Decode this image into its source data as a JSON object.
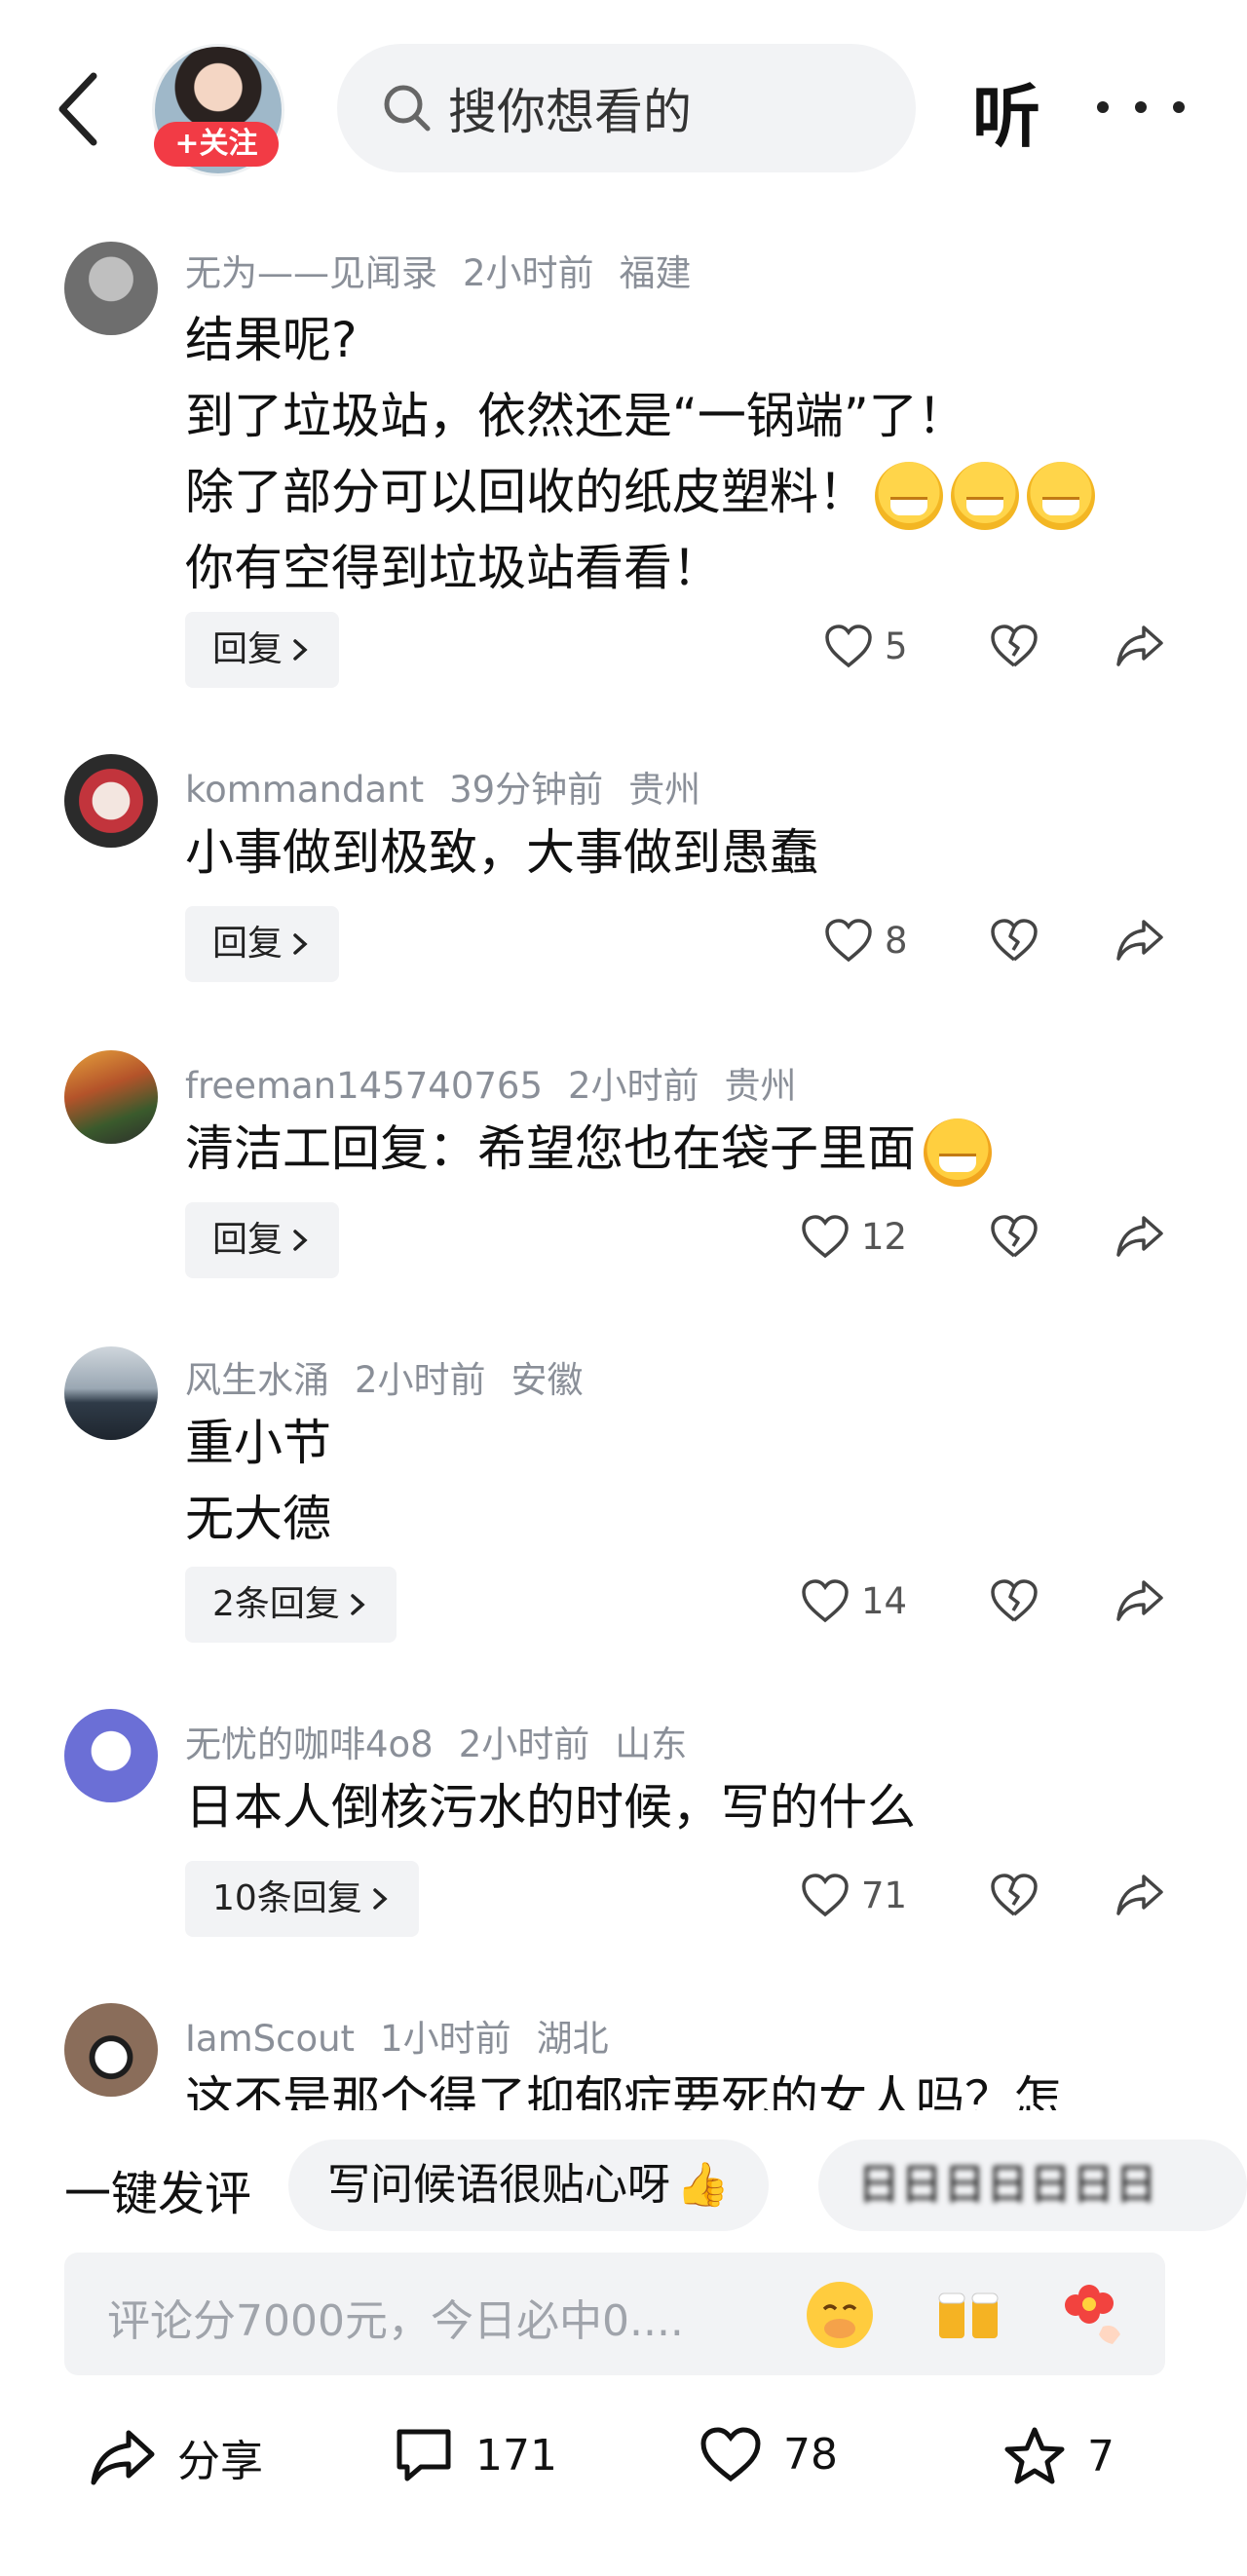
{
  "header": {
    "follow_label": "+关注",
    "search_placeholder": "搜你想看的",
    "listen_label": "听"
  },
  "comments": [
    {
      "user": "无为——见闻录",
      "time": "2小时前",
      "location": "福建",
      "lines": [
        "结果呢?",
        "到了垃圾站，依然还是“一锅端”了！",
        "除了部分可以回收的纸皮塑料！",
        "你有空得到垃圾站看看！"
      ],
      "reply_label": "回复",
      "likes": "5"
    },
    {
      "user": "kommandant",
      "time": "39分钟前",
      "location": "贵州",
      "lines": [
        "小事做到极致，大事做到愚蠢"
      ],
      "reply_label": "回复",
      "likes": "8"
    },
    {
      "user": "freeman145740765",
      "time": "2小时前",
      "location": "贵州",
      "lines": [
        "清洁工回复：希望您也在袋子里面"
      ],
      "reply_label": "回复",
      "likes": "12"
    },
    {
      "user": "风生水涌",
      "time": "2小时前",
      "location": "安徽",
      "lines": [
        "重小节",
        "无大德"
      ],
      "reply_label": "2条回复",
      "likes": "14"
    },
    {
      "user": "无忧的咖啡4o8",
      "time": "2小时前",
      "location": "山东",
      "lines": [
        "日本人倒核污水的时候，写的什么"
      ],
      "reply_label": "10条回复",
      "likes": "71"
    },
    {
      "user": "IamScout",
      "time": "1小时前",
      "location": "湖北",
      "lines": [
        "这不是那个得了抑郁症要死的女人吗？怎"
      ]
    }
  ],
  "quick": {
    "label": "一键发评",
    "chip1": "写问候语很贴心呀",
    "chip2": "日日日日日日日"
  },
  "input": {
    "placeholder": "评论分7000元，今日必中0...."
  },
  "bottom": {
    "share_label": "分享",
    "comments_count": "171",
    "likes_count": "78",
    "favorites_count": "7"
  },
  "colors": {
    "accent_red": "#f23b45",
    "meta_gray": "#8a8f98",
    "chip_bg": "#f2f3f5"
  }
}
